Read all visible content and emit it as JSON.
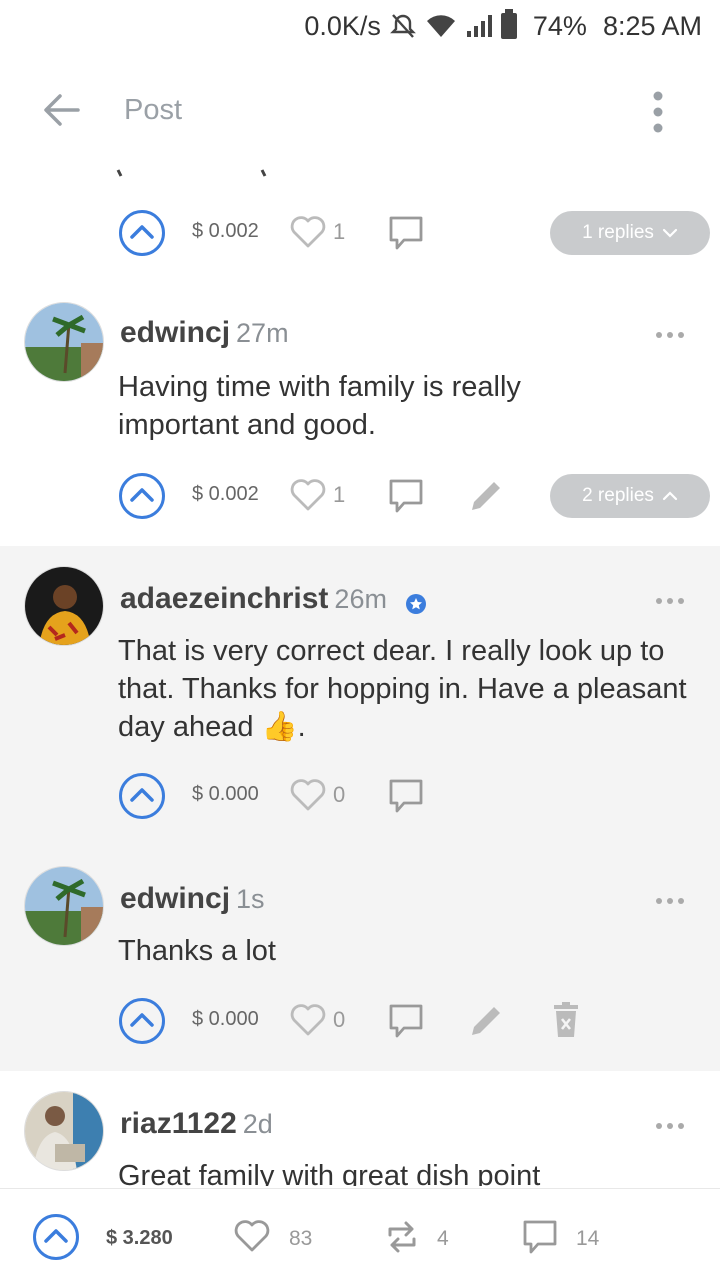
{
  "status_bar": {
    "net_speed": "0.0K/s",
    "battery": "74%",
    "time": "8:25 AM"
  },
  "app_bar": {
    "title": "Post"
  },
  "colors": {
    "accent": "#3b7ddd",
    "replies_bg": "#c9cbcd",
    "highlight_bg": "#f4f4f4"
  },
  "top_actions": {
    "amount": "$ 0.002",
    "likes": "1",
    "replies_label": "1 replies"
  },
  "comments": [
    {
      "author": "edwincj",
      "time": "27m",
      "text": "Having time with family is really important and good.",
      "amount": "$ 0.002",
      "likes": "1",
      "replies_label": "2 replies"
    },
    {
      "author": "adaezeinchrist",
      "time": "26m",
      "text": "That is very correct dear. I really look up to that. Thanks for hopping in. Have a pleasant day ahead 👍.",
      "amount": "$ 0.000",
      "likes": "0"
    },
    {
      "author": "edwincj",
      "time": "1s",
      "text": "Thanks a lot",
      "amount": "$ 0.000",
      "likes": "0"
    },
    {
      "author": "riaz1122",
      "time": "2d",
      "text": "Great family with great dish point"
    }
  ],
  "bottom_bar": {
    "amount": "$ 3.280",
    "likes": "83",
    "resteems": "4",
    "comments": "14"
  }
}
